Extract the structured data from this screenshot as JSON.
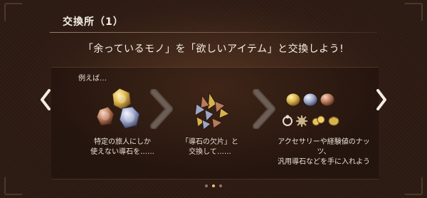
{
  "window": {
    "title": "交換所（1）"
  },
  "main": {
    "headline": "「余っているモノ」を「欲しいアイテム」と交換しよう!",
    "example_label": "例えば…",
    "captions": [
      "特定の旅人にしか\n使えない導石を……",
      "「導石の欠片」と\n交換して……",
      "アクセサリーや経験値のナッツ、\n汎用導石などを手に入れよう"
    ]
  },
  "icons": {
    "left_nav": "chevron-left-icon",
    "right_nav": "chevron-right-icon",
    "arrow_step_1": "arrow-right-icon",
    "arrow_step_2": "arrow-right-icon",
    "example_stones": "guidestone-icon",
    "fragments": "guidestone-fragment-icon",
    "rewards": "reward-items-icon"
  },
  "pager": {
    "active_index": 1,
    "count": 3
  },
  "colors": {
    "background": "#2b1a12",
    "gold": "#d7b14a",
    "silver": "#9da7c7",
    "bronze": "#b97b5a",
    "accent": "#f0c27a"
  }
}
